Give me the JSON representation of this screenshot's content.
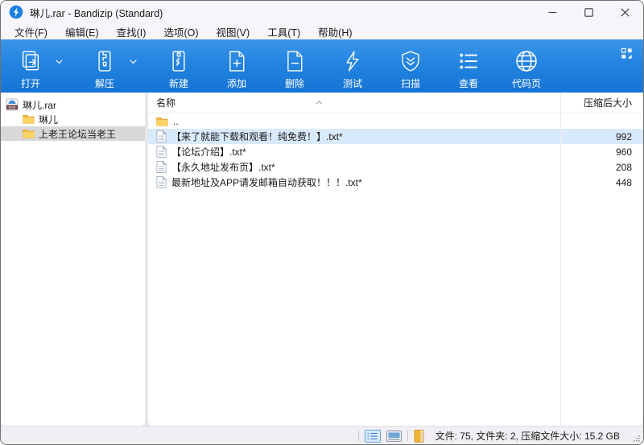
{
  "window": {
    "title": "琳儿.rar - Bandizip (Standard)"
  },
  "menu": {
    "items": [
      "文件(F)",
      "编辑(E)",
      "查找(I)",
      "选项(O)",
      "视图(V)",
      "工具(T)",
      "帮助(H)"
    ]
  },
  "toolbar": {
    "buttons": [
      {
        "label": "打开",
        "icon": "open-archive-icon",
        "dropdown": true
      },
      {
        "label": "解压",
        "icon": "extract-icon",
        "dropdown": true
      },
      {
        "label": "新建",
        "icon": "new-archive-icon",
        "dropdown": false
      },
      {
        "label": "添加",
        "icon": "add-file-icon",
        "dropdown": false
      },
      {
        "label": "删除",
        "icon": "delete-file-icon",
        "dropdown": false
      },
      {
        "label": "测试",
        "icon": "test-lightning-icon",
        "dropdown": false
      },
      {
        "label": "扫描",
        "icon": "scan-shield-icon",
        "dropdown": false
      },
      {
        "label": "查看",
        "icon": "view-list-icon",
        "dropdown": false
      },
      {
        "label": "代码页",
        "icon": "codepage-globe-icon",
        "dropdown": false
      }
    ]
  },
  "sidebar": {
    "items": [
      {
        "label": "琳儿.rar",
        "icon": "rar-archive-icon",
        "level": 0,
        "selected": false
      },
      {
        "label": "琳儿",
        "icon": "folder-icon",
        "level": 1,
        "selected": false
      },
      {
        "label": "上老王论坛当老王",
        "icon": "folder-icon",
        "level": 1,
        "selected": true
      }
    ]
  },
  "filelist": {
    "columns": {
      "name": "名称",
      "size": "压缩后大小"
    },
    "sort": {
      "column": "名称",
      "direction": "ascending",
      "indicator_icon": "chevron-up"
    },
    "rows": [
      {
        "name": "..",
        "icon": "folder-icon",
        "size": "",
        "highlighted": false
      },
      {
        "name": "【来了就能下载和观看！纯免费！】.txt*",
        "icon": "text-file-icon",
        "size": "992",
        "highlighted": true
      },
      {
        "name": "【论坛介绍】.txt*",
        "icon": "text-file-icon",
        "size": "960",
        "highlighted": false
      },
      {
        "name": "【永久地址发布页】.txt*",
        "icon": "text-file-icon",
        "size": "208",
        "highlighted": false
      },
      {
        "name": "最新地址及APP请发邮箱自动获取！！！.txt*",
        "icon": "text-file-icon",
        "size": "448",
        "highlighted": false
      }
    ]
  },
  "statusbar": {
    "summary": "文件: 75, 文件夹: 2, 压缩文件大小: 15.2 GB"
  },
  "colors": {
    "toolbar_top": "#3a95e9",
    "toolbar_bottom": "#1674d4",
    "accent": "#1b7fe4",
    "list_selection": "#d9eafc",
    "sidebar_selection": "#d8d8d8",
    "folder_yellow": "#f9cd55"
  }
}
